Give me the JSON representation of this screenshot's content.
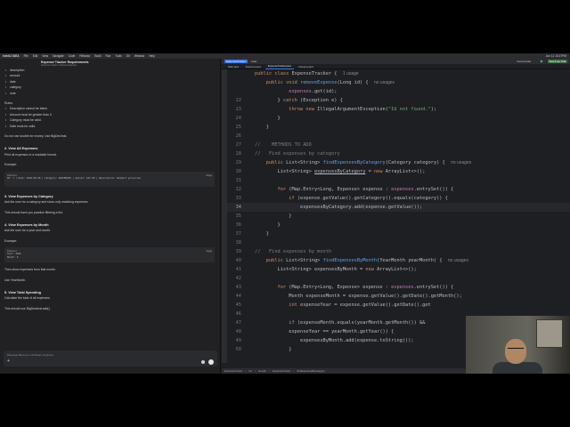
{
  "menubar": {
    "app": "IntelliJ IDEA",
    "items": [
      "File",
      "Edit",
      "View",
      "Navigate",
      "Code",
      "Refactor",
      "Build",
      "Run",
      "Tools",
      "Git",
      "Window",
      "Help"
    ],
    "clock": "Jun 12 10:27PM"
  },
  "chat": {
    "title": "Expense Tracker Requirements",
    "subtitle": "Expense tracker software Engineer",
    "fields": [
      "description",
      "amount",
      "date",
      "category",
      "note"
    ],
    "rules_heading": "Rules:",
    "rules": [
      "Description cannot be blank.",
      "Amount must be greater than 0.",
      "Category must be valid.",
      "Date must be valid."
    ],
    "money_note": "Do not use double for money. Use BigDecimal.",
    "s2_title": "2. View All Expenses",
    "s2_text": "Print all expenses in a readable format.",
    "example_label": "Example:",
    "code1_lang": "Plaintext",
    "code1_body": "ID: 1 | Date: 2026-06-09 | Category: GROCERIES | Amount: $47.00 | Description: Walmart groceries",
    "copy_label": "Copy",
    "s3_title": "3. View Expenses by Category",
    "s3_text": "Ask the user for a category and show only matching expenses.",
    "s3_note": "This should have you practice filtering a list.",
    "s4_title": "4. View Expenses by Month",
    "s4_text": "Ask the user for a year and month.",
    "code2_lang": "Plaintext",
    "code2_body": "Year: 2026\nMonth: 6",
    "s4_after": "Then show expenses from that month.",
    "s4_use": "Use YearMonth.",
    "s5_title": "5. View Total Spending",
    "s5_text": "Calculate the total of all expenses.",
    "s5_note": "This should use BigDecimal.add().",
    "input_placeholder": "Message Become a Software Engineer"
  },
  "ide": {
    "project": "ExpenseTracker",
    "branch": "main",
    "run_config": "Current File",
    "trial_label": "Start Free Trial",
    "tabs": [
      "Main.java",
      "Expense.java",
      "ExpenseTracker.java",
      "Category.java"
    ],
    "active_tab": "ExpenseTracker.java",
    "status_path": [
      "ExpenseTracker",
      "src",
      "domain",
      "ExpenseTracker",
      "findExpensesByCategory"
    ]
  },
  "code": {
    "usage_hint": "no usages",
    "usage_hint_short": "1 usage"
  }
}
